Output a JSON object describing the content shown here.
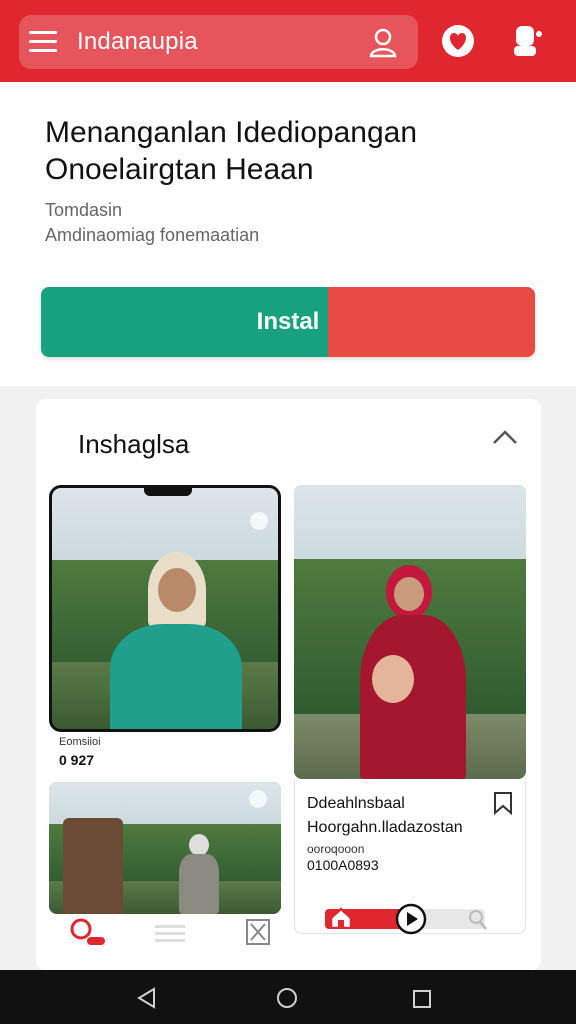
{
  "topbar": {
    "title": "Indanaupia",
    "accent": "#e0262f"
  },
  "app": {
    "title_line1": "Menanganlan Idediopangan",
    "title_line2": "Onoelairgtan Heaan",
    "meta1": "Tomdasin",
    "meta2": "Amdinaomiag fonemaatian",
    "install_label": "Instal",
    "install_colors": [
      "#18a17f",
      "#e74b43"
    ]
  },
  "section": {
    "title": "Inshaglsa"
  },
  "cards": {
    "card1": {
      "caption1": "Eomsiioi",
      "caption2": "0 927"
    },
    "card2": {
      "title1": "Ddeahlnsbaal",
      "title2": "Hoorgahn.lladazostan",
      "meta1": "ooroqooon",
      "meta2": "0100A0893"
    }
  },
  "icons": [
    "menu-icon",
    "user-icon",
    "heart-icon",
    "profile-icon",
    "chevron-up-icon",
    "bookmark-icon",
    "home-icon",
    "play-icon",
    "search-icon",
    "back-icon",
    "recent-apps-icon"
  ]
}
